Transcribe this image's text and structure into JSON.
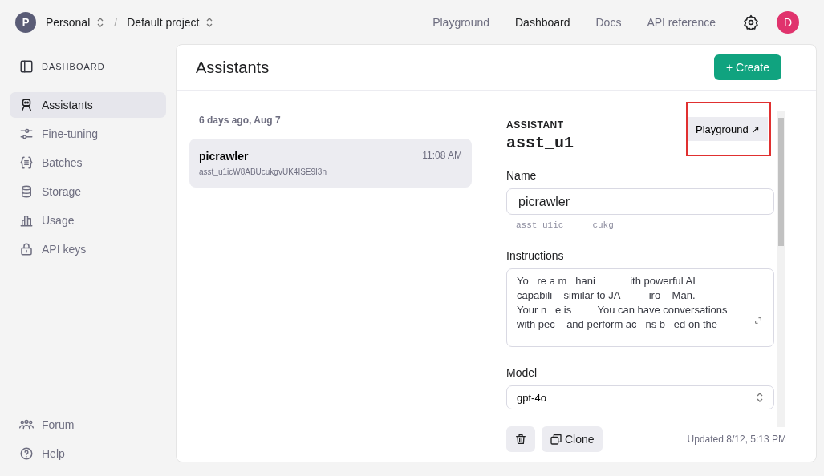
{
  "topbar": {
    "org_initial": "P",
    "org": "Personal",
    "separator": "/",
    "project": "Default project",
    "nav": [
      {
        "label": "Playground",
        "selected": false
      },
      {
        "label": "Dashboard",
        "selected": true
      },
      {
        "label": "Docs",
        "selected": false
      },
      {
        "label": "API reference",
        "selected": false
      }
    ],
    "user_initial": "D"
  },
  "sidebar": {
    "title": "DASHBOARD",
    "items": [
      {
        "label": "Assistants",
        "selected": true
      },
      {
        "label": "Fine-tuning",
        "selected": false
      },
      {
        "label": "Batches",
        "selected": false
      },
      {
        "label": "Storage",
        "selected": false
      },
      {
        "label": "Usage",
        "selected": false
      },
      {
        "label": "API keys",
        "selected": false
      }
    ],
    "footer": [
      {
        "label": "Forum"
      },
      {
        "label": "Help"
      }
    ]
  },
  "page": {
    "title": "Assistants",
    "create_button": "+ Create"
  },
  "list": {
    "group_label": "6 days ago, Aug 7",
    "items": [
      {
        "name": "picrawler",
        "time": "11:08 AM",
        "id": "asst_u1icW8ABUcukgvUK4ISE9I3n",
        "selected": true
      }
    ]
  },
  "detail": {
    "section_label": "ASSISTANT",
    "id_heading": "asst_u1",
    "playground_button": "Playground ↗",
    "name_label": "Name",
    "name_value": "picrawler",
    "id_fragments": [
      "asst_u1ic",
      "cukg"
    ],
    "instructions_label": "Instructions",
    "instructions_lines": [
      "Yo   re a m   hani            ith powerful AI",
      "capabili    similar to JA          iro    Man.",
      "Your n   e is         You can have conversations",
      "with pec    and perform ac   ns b   ed on the"
    ],
    "model_label": "Model",
    "model_value": "gpt-4o",
    "clone_button": "Clone",
    "updated": "Updated 8/12, 5:13 PM"
  }
}
